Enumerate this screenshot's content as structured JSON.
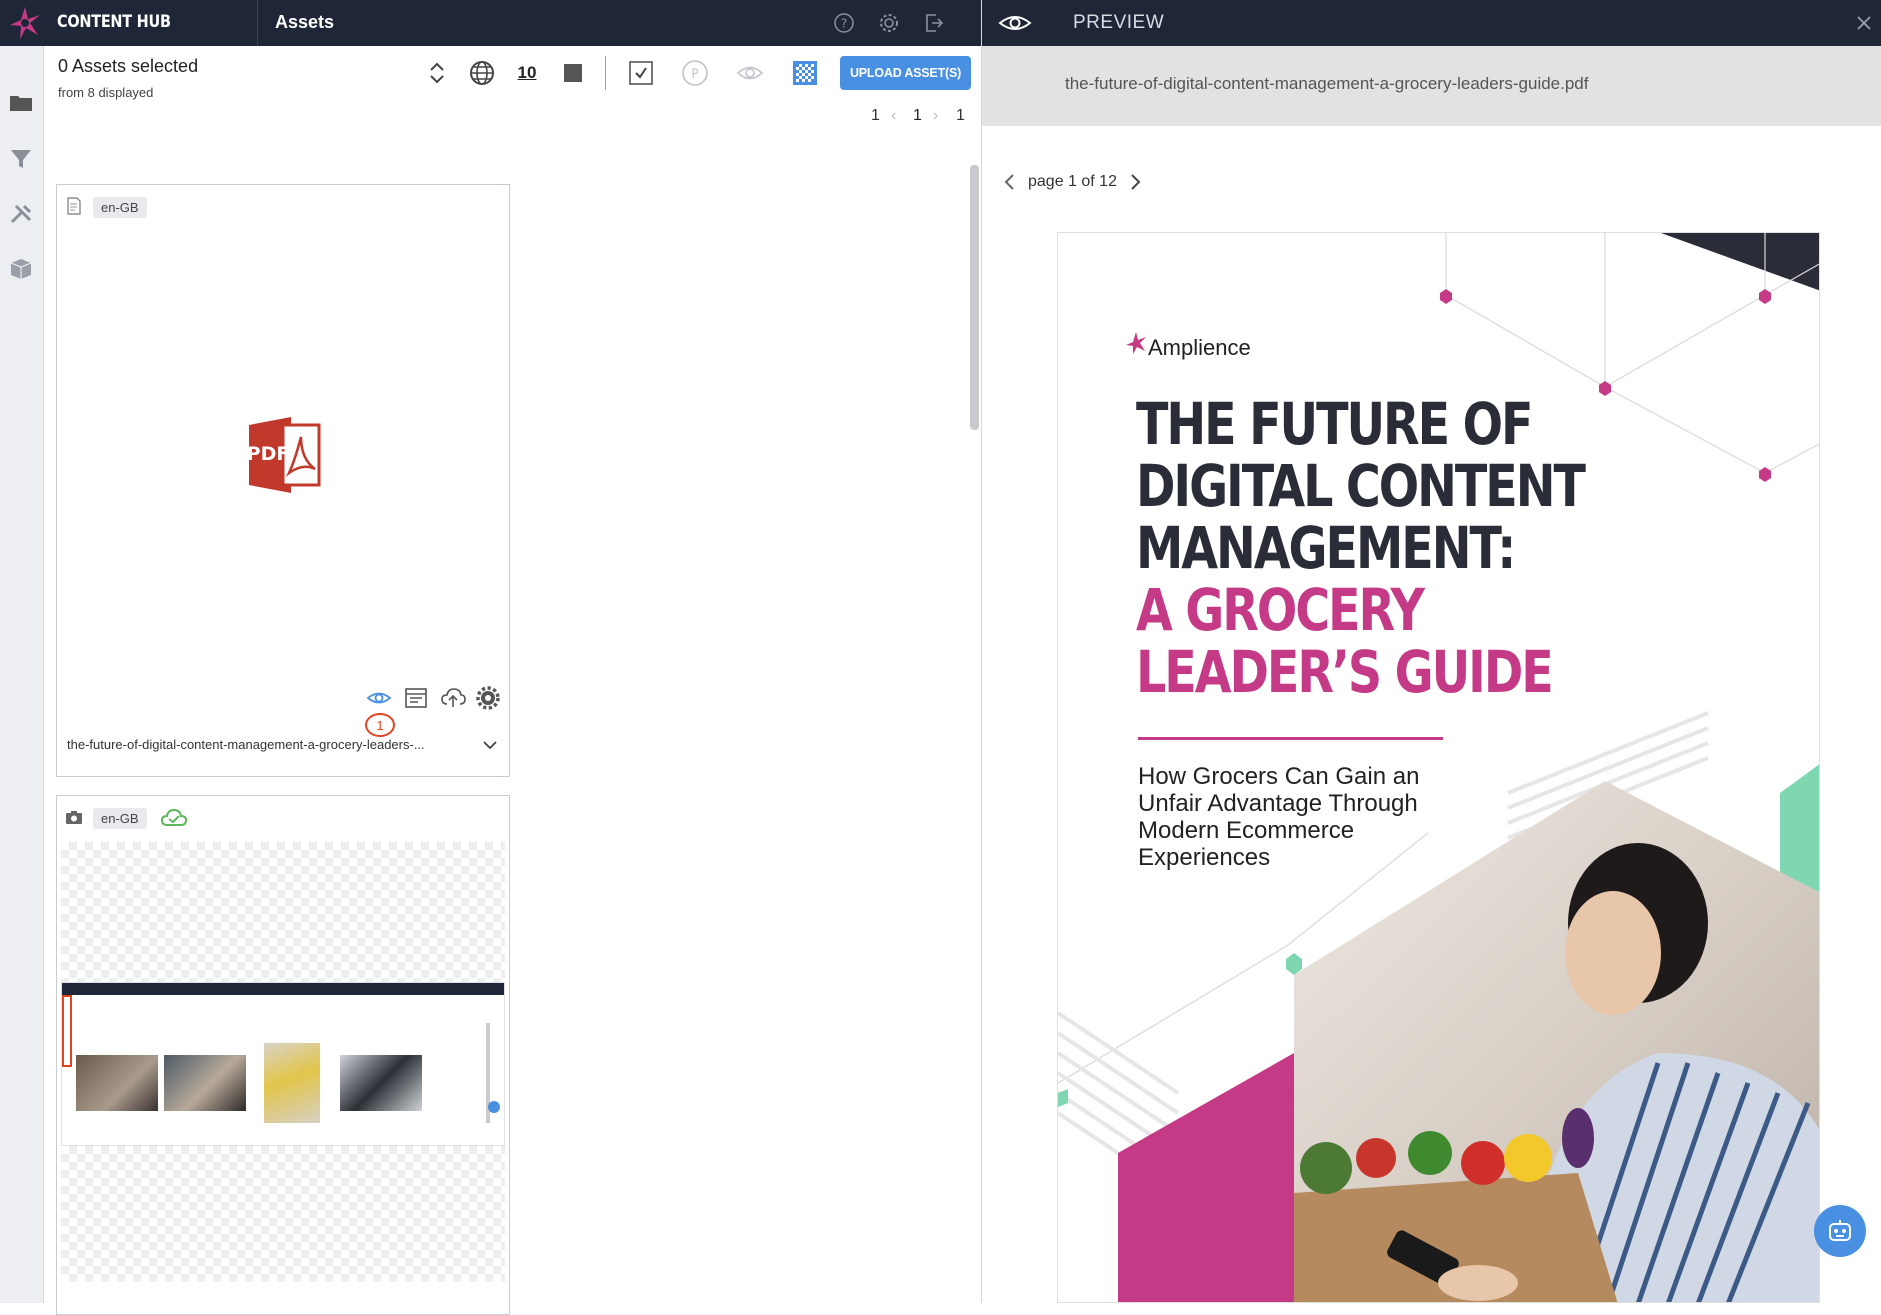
{
  "app": {
    "brand": "CONTENT HUB",
    "section": "Assets"
  },
  "header_icons": [
    "help-icon",
    "gear-icon",
    "logout-icon"
  ],
  "toolbar": {
    "selected_count": "0 Assets selected",
    "displayed": "from 8 displayed",
    "page_size": "10",
    "upload_label": "UPLOAD ASSET(S)"
  },
  "pagination": {
    "first": "1",
    "current": "1",
    "last": "1"
  },
  "assets": [
    {
      "type_icon": "document-icon",
      "locale": "en-GB",
      "filename": "the-future-of-digital-content-management-a-grocery-leaders-...",
      "badge": "1"
    },
    {
      "type_icon": "camera-icon",
      "locale": "en-GB",
      "status_icon": "cloud-check-icon"
    }
  ],
  "preview": {
    "title": "PREVIEW",
    "filename": "the-future-of-digital-content-management-a-grocery-leaders-guide.pdf",
    "page_text": "page 1 of 12",
    "doc": {
      "brand": "Amplience",
      "title_lines": [
        "THE FUTURE OF",
        "DIGITAL CONTENT",
        "MANAGEMENT:"
      ],
      "title_pink_lines": [
        "A GROCERY",
        "LEADER’S GUIDE"
      ],
      "subtitle": "How Grocers Can Gain an Unfair Advantage Through Modern Ecommerce Experiences"
    }
  },
  "colors": {
    "header_bg": "#1f2638",
    "accent_blue": "#4a90e2",
    "brand_pink": "#c53a86",
    "alert_red": "#d0021b"
  }
}
